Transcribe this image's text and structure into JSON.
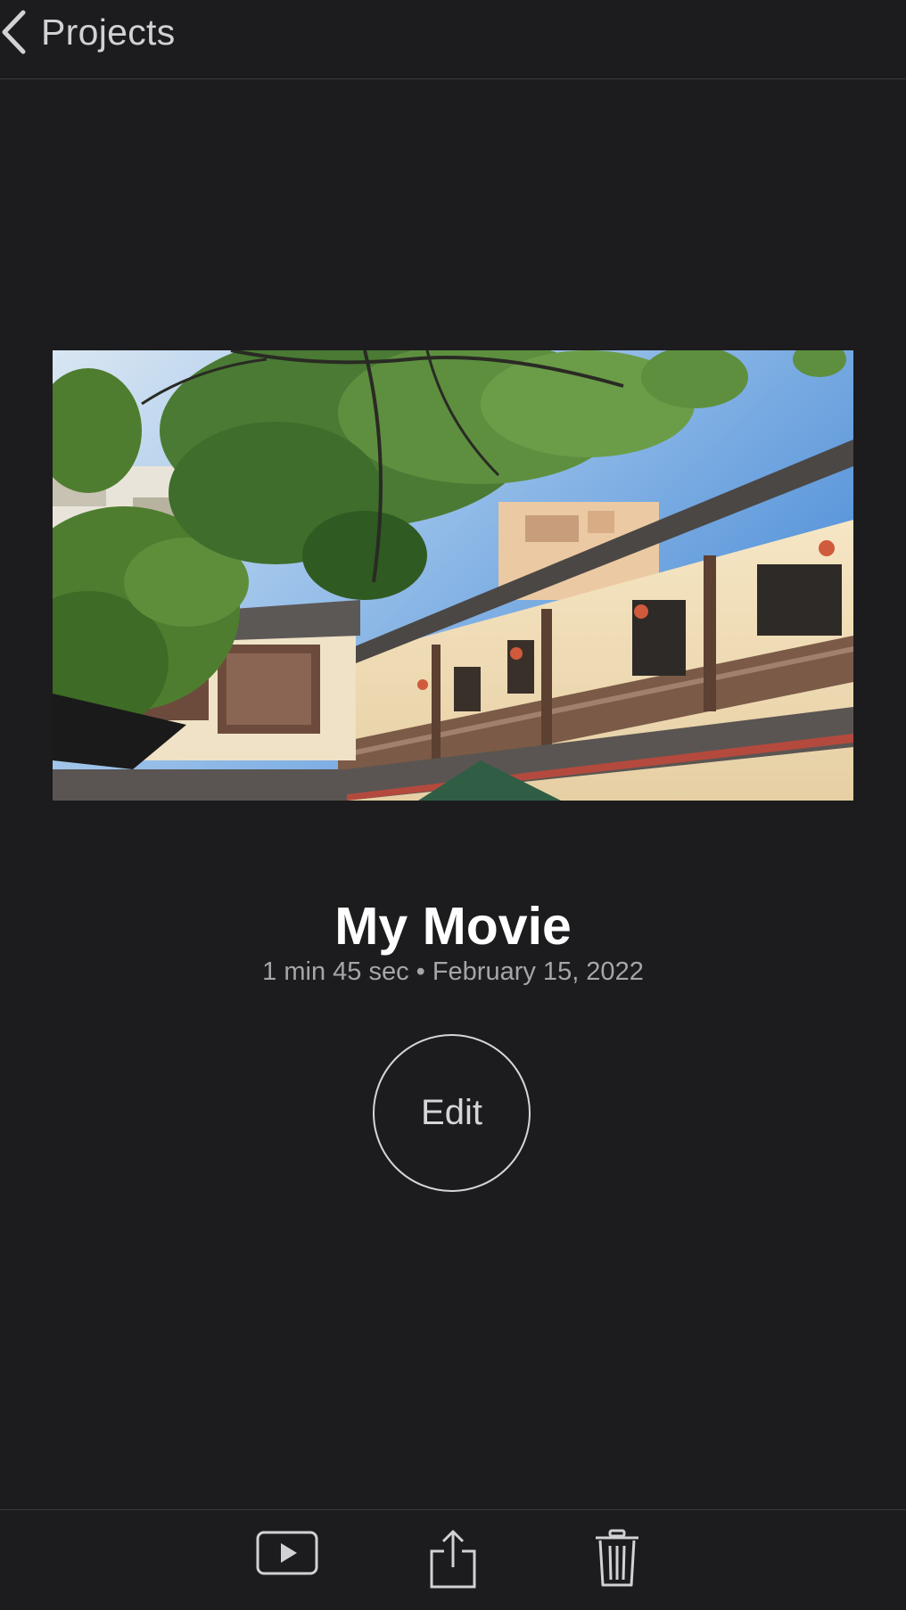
{
  "nav": {
    "back_label": "Projects"
  },
  "project": {
    "title": "My Movie",
    "subtitle": "1 min 45 sec • February 15, 2022"
  },
  "edit_button": {
    "label": "Edit"
  },
  "toolbar": {
    "items": [
      {
        "icon": "play-icon"
      },
      {
        "icon": "share-icon"
      },
      {
        "icon": "trash-icon"
      }
    ]
  },
  "colors": {
    "background": "#1c1c1e",
    "text_primary": "#ffffff",
    "text_secondary": "#a5a5aa",
    "icon": "#d1d1d6"
  }
}
